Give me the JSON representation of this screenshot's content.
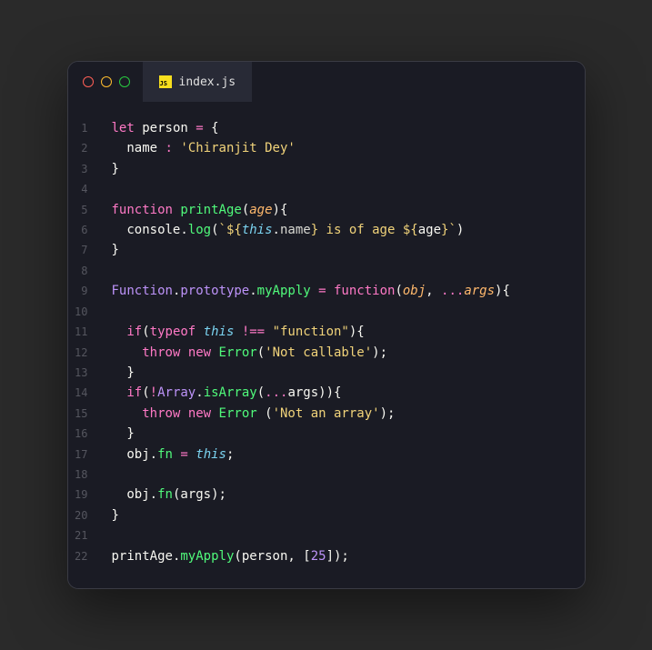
{
  "tab": {
    "filename": "index.js",
    "icon_label": "JS"
  },
  "code": {
    "lines": [
      {
        "n": "1",
        "tokens": [
          [
            "kw",
            "let"
          ],
          [
            "var",
            " person "
          ],
          [
            "op",
            "="
          ],
          [
            "var",
            " "
          ],
          [
            "punc",
            "{"
          ]
        ]
      },
      {
        "n": "2",
        "tokens": [
          [
            "var",
            "  name "
          ],
          [
            "op",
            ":"
          ],
          [
            "var",
            " "
          ],
          [
            "str",
            "'Chiranjit Dey'"
          ]
        ]
      },
      {
        "n": "3",
        "tokens": [
          [
            "punc",
            "}"
          ]
        ]
      },
      {
        "n": "4",
        "tokens": []
      },
      {
        "n": "5",
        "tokens": [
          [
            "kw",
            "function"
          ],
          [
            "var",
            " "
          ],
          [
            "fn",
            "printAge"
          ],
          [
            "punc",
            "("
          ],
          [
            "param",
            "age"
          ],
          [
            "punc",
            "){"
          ]
        ]
      },
      {
        "n": "6",
        "tokens": [
          [
            "var",
            "  console"
          ],
          [
            "punc",
            "."
          ],
          [
            "fn",
            "log"
          ],
          [
            "punc",
            "("
          ],
          [
            "str",
            "`${"
          ],
          [
            "kw2",
            "this"
          ],
          [
            "punc",
            "."
          ],
          [
            "prop",
            "name"
          ],
          [
            "str",
            "} is of age ${"
          ],
          [
            "var",
            "age"
          ],
          [
            "str",
            "}`"
          ],
          [
            "punc",
            ")"
          ]
        ]
      },
      {
        "n": "7",
        "tokens": [
          [
            "punc",
            "}"
          ]
        ]
      },
      {
        "n": "8",
        "tokens": []
      },
      {
        "n": "9",
        "tokens": [
          [
            "const",
            "Function"
          ],
          [
            "punc",
            "."
          ],
          [
            "const",
            "prototype"
          ],
          [
            "punc",
            "."
          ],
          [
            "fn",
            "myApply"
          ],
          [
            "var",
            " "
          ],
          [
            "op",
            "="
          ],
          [
            "var",
            " "
          ],
          [
            "kw",
            "function"
          ],
          [
            "punc",
            "("
          ],
          [
            "param",
            "obj"
          ],
          [
            "punc",
            ", "
          ],
          [
            "op",
            "..."
          ],
          [
            "param",
            "args"
          ],
          [
            "punc",
            "){"
          ]
        ]
      },
      {
        "n": "10",
        "tokens": []
      },
      {
        "n": "11",
        "tokens": [
          [
            "var",
            "  "
          ],
          [
            "kw",
            "if"
          ],
          [
            "punc",
            "("
          ],
          [
            "kw",
            "typeof"
          ],
          [
            "var",
            " "
          ],
          [
            "kw2",
            "this"
          ],
          [
            "var",
            " "
          ],
          [
            "op",
            "!=="
          ],
          [
            "var",
            " "
          ],
          [
            "str",
            "\"function\""
          ],
          [
            "punc",
            "){"
          ]
        ]
      },
      {
        "n": "12",
        "tokens": [
          [
            "var",
            "    "
          ],
          [
            "kw",
            "throw"
          ],
          [
            "var",
            " "
          ],
          [
            "kw",
            "new"
          ],
          [
            "var",
            " "
          ],
          [
            "fn",
            "Error"
          ],
          [
            "punc",
            "("
          ],
          [
            "str",
            "'Not callable'"
          ],
          [
            "punc",
            ");"
          ]
        ]
      },
      {
        "n": "13",
        "tokens": [
          [
            "var",
            "  "
          ],
          [
            "punc",
            "}"
          ]
        ]
      },
      {
        "n": "14",
        "tokens": [
          [
            "var",
            "  "
          ],
          [
            "kw",
            "if"
          ],
          [
            "punc",
            "("
          ],
          [
            "op",
            "!"
          ],
          [
            "const",
            "Array"
          ],
          [
            "punc",
            "."
          ],
          [
            "fn",
            "isArray"
          ],
          [
            "punc",
            "("
          ],
          [
            "op",
            "..."
          ],
          [
            "var",
            "args"
          ],
          [
            "punc",
            ")){"
          ]
        ]
      },
      {
        "n": "15",
        "tokens": [
          [
            "var",
            "    "
          ],
          [
            "kw",
            "throw"
          ],
          [
            "var",
            " "
          ],
          [
            "kw",
            "new"
          ],
          [
            "var",
            " "
          ],
          [
            "fn",
            "Error"
          ],
          [
            "var",
            " "
          ],
          [
            "punc",
            "("
          ],
          [
            "str",
            "'Not an array'"
          ],
          [
            "punc",
            ");"
          ]
        ]
      },
      {
        "n": "16",
        "tokens": [
          [
            "var",
            "  "
          ],
          [
            "punc",
            "}"
          ]
        ]
      },
      {
        "n": "17",
        "tokens": [
          [
            "var",
            "  obj"
          ],
          [
            "punc",
            "."
          ],
          [
            "fn",
            "fn"
          ],
          [
            "var",
            " "
          ],
          [
            "op",
            "="
          ],
          [
            "var",
            " "
          ],
          [
            "kw2",
            "this"
          ],
          [
            "punc",
            ";"
          ]
        ]
      },
      {
        "n": "18",
        "tokens": []
      },
      {
        "n": "19",
        "tokens": [
          [
            "var",
            "  obj"
          ],
          [
            "punc",
            "."
          ],
          [
            "fn",
            "fn"
          ],
          [
            "punc",
            "("
          ],
          [
            "var",
            "args"
          ],
          [
            "punc",
            ");"
          ]
        ]
      },
      {
        "n": "20",
        "tokens": [
          [
            "punc",
            "}"
          ]
        ]
      },
      {
        "n": "21",
        "tokens": []
      },
      {
        "n": "22",
        "tokens": [
          [
            "var",
            "printAge"
          ],
          [
            "punc",
            "."
          ],
          [
            "fn",
            "myApply"
          ],
          [
            "punc",
            "("
          ],
          [
            "var",
            "person"
          ],
          [
            "punc",
            ", ["
          ],
          [
            "num",
            "25"
          ],
          [
            "punc",
            "]);"
          ]
        ]
      }
    ]
  }
}
